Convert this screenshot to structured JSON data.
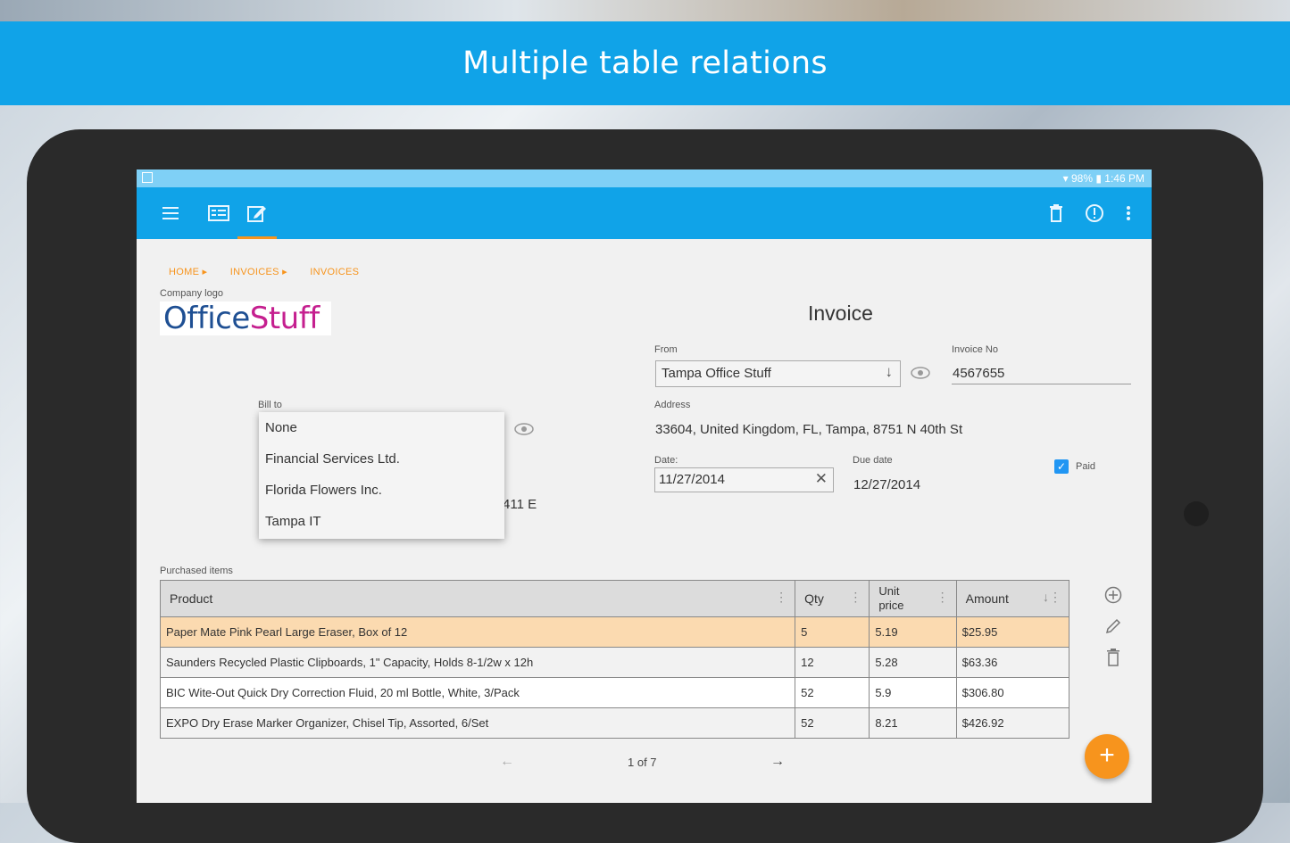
{
  "banner": {
    "title": "Multiple table relations"
  },
  "statusbar": {
    "battery": "98%",
    "time": "1:46 PM"
  },
  "appbar": {
    "icons": [
      "menu-icon",
      "list-view-icon",
      "edit-icon",
      "delete-icon",
      "info-icon",
      "more-vert-icon"
    ]
  },
  "breadcrumb": {
    "items": [
      "HOME ▸",
      "INVOICES ▸",
      "INVOICES"
    ]
  },
  "form": {
    "company_logo_label": "Company logo",
    "logo": {
      "part1": "Office",
      "part2": "Stuff",
      "color1": "#1e4f93",
      "color2": "#c51f8f"
    },
    "title": "Invoice",
    "from_label": "From",
    "from_value": "Tampa Office Stuff",
    "invoice_no_label": "Invoice No",
    "invoice_no_value": "4567655",
    "bill_to_label": "Bill to",
    "bill_to_options": [
      "None",
      "Financial Services Ltd.",
      "Florida Flowers Inc.",
      "Tampa IT"
    ],
    "bill_to_address_fragment": "411 E",
    "address_label": "Address",
    "address_value": "33604, United Kingdom, FL, Tampa, 8751 N 40th St",
    "date_label": "Date:",
    "date_value": "11/27/2014",
    "due_date_label": "Due date",
    "due_date_value": "12/27/2014",
    "paid_label": "Paid",
    "paid_checked": true
  },
  "items": {
    "label": "Purchased items",
    "columns": [
      "Product",
      "Qty",
      "Unit price",
      "Amount"
    ],
    "rows": [
      {
        "product": "Paper Mate Pink Pearl Large Eraser, Box of 12",
        "qty": "5",
        "unit_price": "5.19",
        "amount": "$25.95"
      },
      {
        "product": "Saunders Recycled Plastic Clipboards, 1\" Capacity, Holds 8-1/2w x 12h",
        "qty": "12",
        "unit_price": "5.28",
        "amount": "$63.36"
      },
      {
        "product": "BIC Wite-Out Quick Dry Correction Fluid, 20 ml Bottle, White, 3/Pack",
        "qty": "52",
        "unit_price": "5.9",
        "amount": "$306.80"
      },
      {
        "product": "EXPO Dry Erase Marker Organizer, Chisel Tip, Assorted, 6/Set",
        "qty": "52",
        "unit_price": "8.21",
        "amount": "$426.92"
      }
    ],
    "pager": {
      "text": "1 of 7",
      "prev": "←",
      "next": "→"
    }
  },
  "colors": {
    "accent": "#10a3e8",
    "orange": "#f7941d",
    "selected_row": "#fbdab0"
  }
}
